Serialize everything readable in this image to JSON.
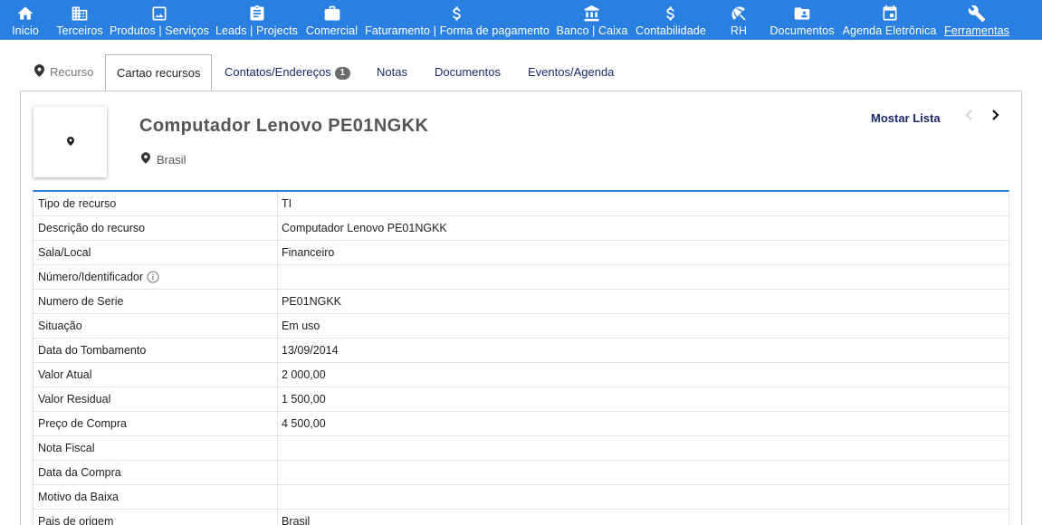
{
  "nav": [
    {
      "label": "Inicio",
      "icon": "home-icon"
    },
    {
      "label": "Terceiros",
      "icon": "building-icon"
    },
    {
      "label": "Produtos | Serviços",
      "icon": "image-icon"
    },
    {
      "label": "Leads | Projects",
      "icon": "clipboard-icon"
    },
    {
      "label": "Comercial",
      "icon": "briefcase-icon"
    },
    {
      "label": "Faturamento | Forma de pagamento",
      "icon": "dollar-icon"
    },
    {
      "label": "Banco | Caixa",
      "icon": "bank-icon"
    },
    {
      "label": "Contabilidade",
      "icon": "dollar-icon"
    },
    {
      "label": "RH",
      "icon": "umbrella-icon"
    },
    {
      "label": "Documentos",
      "icon": "folder-user-icon"
    },
    {
      "label": "Agenda Eletrônica",
      "icon": "calendar-icon"
    },
    {
      "label": "Ferramentas",
      "icon": "wrench-icon"
    }
  ],
  "tabs": [
    {
      "label": "Recurso"
    },
    {
      "label": "Cartao recursos"
    },
    {
      "label": "Contatos/Endereços",
      "badge": "1"
    },
    {
      "label": "Notas"
    },
    {
      "label": "Documentos"
    },
    {
      "label": "Eventos/Agenda"
    }
  ],
  "resource": {
    "title": "Computador Lenovo PE01NGKK",
    "country": "Brasil"
  },
  "actions": {
    "show_list": "Mostar Lista"
  },
  "fields": [
    {
      "label": "Tipo de recurso",
      "value": "TI"
    },
    {
      "label": "Descrição do recurso",
      "value": "Computador Lenovo PE01NGKK"
    },
    {
      "label": "Sala/Local",
      "value": "Financeiro"
    },
    {
      "label": "Número/Identificador",
      "value": ""
    },
    {
      "label": "Numero de Serie",
      "value": "PE01NGKK"
    },
    {
      "label": "Situação",
      "value": "Em uso"
    },
    {
      "label": "Data do Tombamento",
      "value": "13/09/2014"
    },
    {
      "label": "Valor Atual",
      "value": "2 000,00"
    },
    {
      "label": "Valor Residual",
      "value": "1 500,00"
    },
    {
      "label": "Preço de Compra",
      "value": "4 500,00"
    },
    {
      "label": "Nota Fiscal",
      "value": ""
    },
    {
      "label": "Data da Compra",
      "value": ""
    },
    {
      "label": "Motivo da Baixa",
      "value": ""
    },
    {
      "label": "Pais de origem",
      "value": "Brasil"
    }
  ],
  "colors": {
    "nav_bg": "#2a80e0",
    "link": "#1a2a6c",
    "table_accent": "#2a80e0"
  }
}
